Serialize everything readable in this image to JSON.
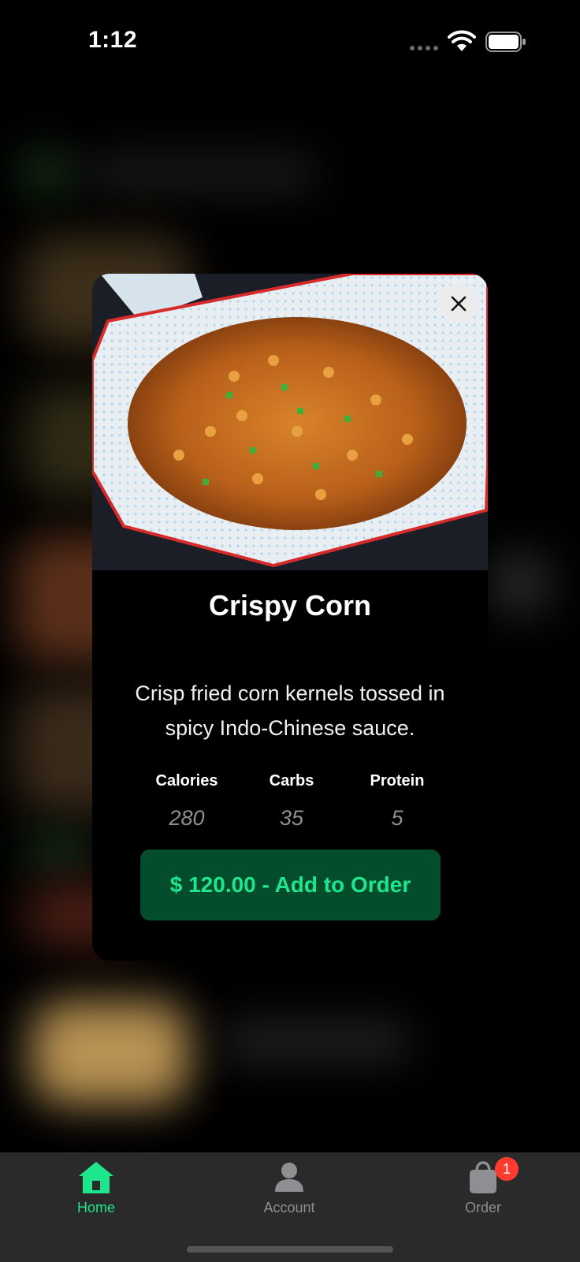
{
  "status_bar": {
    "time": "1:12"
  },
  "modal": {
    "title": "Crispy Corn",
    "description": "Crisp fried corn kernels tossed in spicy Indo-Chinese sauce.",
    "nutrition": [
      {
        "label": "Calories",
        "value": "280"
      },
      {
        "label": "Carbs",
        "value": "35"
      },
      {
        "label": "Protein",
        "value": "5"
      }
    ],
    "add_button_label": "$ 120.00 - Add to Order",
    "close_icon": "close-icon",
    "image": "crispy-corn-photo"
  },
  "tab_bar": {
    "tabs": [
      {
        "label": "Home",
        "icon": "home-icon",
        "active": true
      },
      {
        "label": "Account",
        "icon": "person-icon",
        "active": false
      },
      {
        "label": "Order",
        "icon": "bag-icon",
        "active": false
      }
    ],
    "order_badge": "1"
  },
  "colors": {
    "accent": "#1ee68c",
    "button_bg": "#044d2c",
    "badge": "#ff3b30",
    "tabbar_bg": "#2a2a2a"
  }
}
